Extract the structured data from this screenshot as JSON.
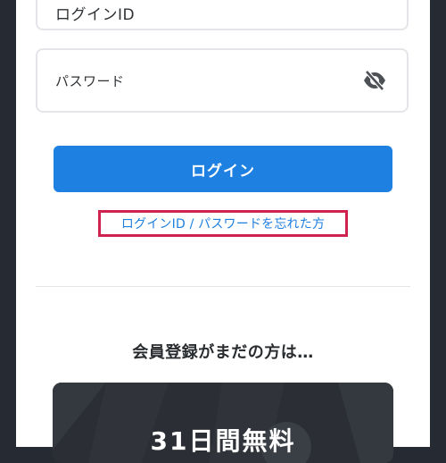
{
  "login_form": {
    "login_id_placeholder": "ログインID",
    "password_placeholder": "パスワード",
    "password_toggle_icon": "eye-slash-icon",
    "login_button_label": "ログイン",
    "forgot_link_text": "ログインID / パスワードを忘れた方"
  },
  "registration": {
    "heading": "会員登録がまだの方は…",
    "promo_title": "31日間無料"
  },
  "colors": {
    "primary": "#1e80e0",
    "highlight_border": "#d0224e",
    "header_dark": "#262b33",
    "promo_background": "#2b2e34"
  }
}
